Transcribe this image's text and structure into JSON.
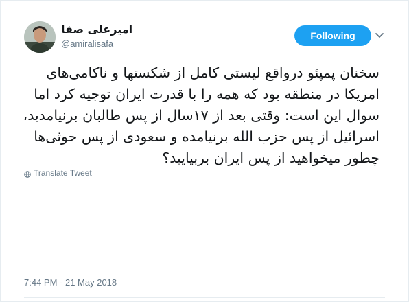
{
  "user": {
    "display_name": "امیرعلی صفا",
    "handle": "@amiralisafa"
  },
  "follow_button": {
    "label": "Following",
    "color": "#1da1f2"
  },
  "menu": {
    "icon": "chevron-down-icon"
  },
  "tweet": {
    "lines": [
      "سخنان پمپئو درواقع لیستی کامل از شکستها و ناکامی‌های",
      "امریکا در منطقه بود که همه را با قدرت ایران توجیه کرد اما",
      "سوال این است: وقتی بعد از ۱۷سال از پس طالبان برنیامدید،",
      "اسرائیل از پس حزب الله برنیامده و سعودی از پس حوثی‌ها",
      "چطور میخواهید از پس ایران بربیایید؟"
    ]
  },
  "translate": {
    "icon": "globe-icon",
    "label": "Translate Tweet"
  },
  "timestamp": "7:44 PM - 21 May 2018"
}
